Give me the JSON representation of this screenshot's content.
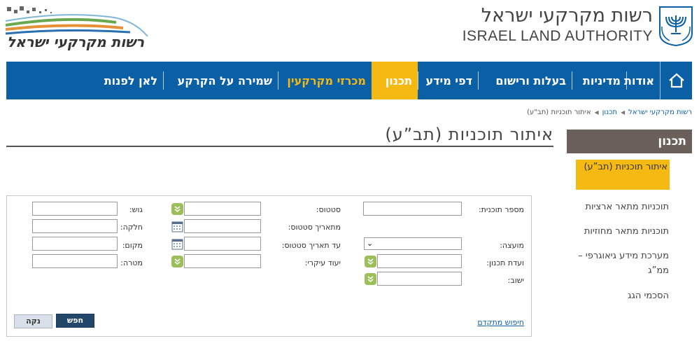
{
  "header": {
    "title_he": "רשות מקרקעי ישראל",
    "title_en": "ISRAEL LAND AUTHORITY",
    "logo_text": "רשות מקרקעי ישראל"
  },
  "nav": {
    "items": [
      {
        "label": "אודות"
      },
      {
        "label": "מדיניות"
      },
      {
        "label": "בעלות ורישום"
      },
      {
        "label": "דפי מידע"
      },
      {
        "label": "תכנון"
      },
      {
        "label": "מכרזי מקרקעין"
      },
      {
        "label": "שמירה על הקרקע"
      },
      {
        "label": "לאן לפנות"
      }
    ]
  },
  "breadcrumb": [
    "רשות מקרקעי ישראל",
    "תכנון",
    "איתור תוכניות (תב\"ע)"
  ],
  "page_title": "איתור תוכניות (תב”ע)",
  "sidebar": {
    "heading": "תכנון",
    "items": [
      {
        "label": "איתור תוכניות (תב”ע)"
      },
      {
        "label": "תוכניות מתאר ארציות"
      },
      {
        "label": "תוכניות מתאר מחוזיות"
      },
      {
        "label": "מערכת מידע גיאוגרפי – ממ”ג"
      },
      {
        "label": "הסכמי הגג"
      }
    ]
  },
  "form": {
    "plan_number": "מספר תוכנית:",
    "council": "מועצה:",
    "planning_committee": "ועדת תכנון:",
    "settlement": "ישוב:",
    "status": "סטטוס:",
    "status_date": "מתאריך סטטוס:",
    "to_status_date": "עד תאריך סטטוס:",
    "main_use": "יעוד עיקרי:",
    "block": "גוש:",
    "parcel": "חלקה:",
    "place": "מקום:",
    "purpose": "מטרה:",
    "search_button": "חפש",
    "clear_button": "נקה",
    "advanced_search": "חיפוש מתקדם"
  },
  "colors": {
    "nav_bg": "#0b5fa5",
    "accent": "#f5b914",
    "sidebar_head": "#6a5f59"
  }
}
